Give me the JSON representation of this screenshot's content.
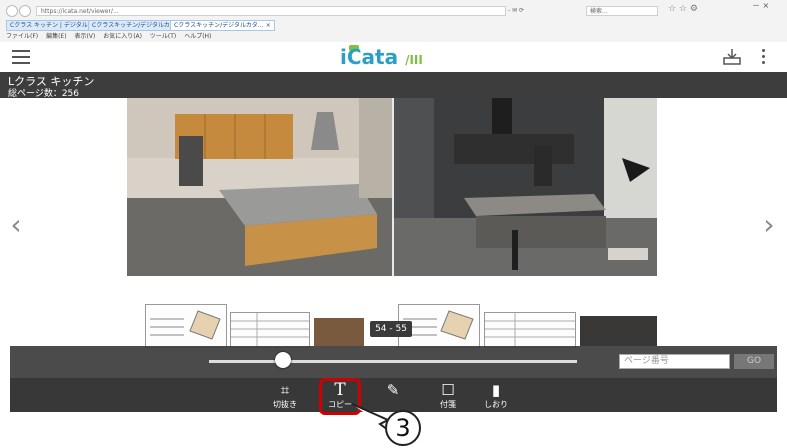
{
  "browser": {
    "url": "https://icata.net/viewer/...",
    "address_right": "- ✉ ⟳",
    "search_placeholder": "検索...",
    "tabs": [
      "Cクラス キッチン | デジタルカタ…",
      "Cクラスキッチン/デジタルカタ… ×",
      "Cクラスキッチン/デジタルカタ… ×"
    ],
    "menu": [
      "ファイル(F)",
      "編集(E)",
      "表示(V)",
      "お気に入り(A)",
      "ツール(T)",
      "ヘルプ(H)"
    ]
  },
  "app": {
    "logo": "iCata",
    "logo_suffix": "/III"
  },
  "catalog": {
    "title": "Lクラス キッチン",
    "total_pages": "総ページ数：256"
  },
  "viewer": {
    "prev_arrow": "‹",
    "next_arrow": "›",
    "page_indicator": "54 - 55",
    "slider_fraction": 0.2
  },
  "page_jump": {
    "placeholder": "ページ番号",
    "go_label": "GO"
  },
  "toolbar": {
    "items": [
      {
        "icon": "crop-icon",
        "glyph": "⌗",
        "label": "切抜き"
      },
      {
        "icon": "text-copy-icon",
        "glyph": "T",
        "label": "コピー"
      },
      {
        "icon": "pen-icon",
        "glyph": "✎",
        "label": "ペン"
      },
      {
        "icon": "sticky-note-icon",
        "glyph": "☐",
        "label": "付箋"
      },
      {
        "icon": "bookmark-icon",
        "glyph": "▮",
        "label": "しおり"
      }
    ]
  },
  "annotation": {
    "step_number": "3",
    "highlight_color": "#d10000"
  },
  "colors": {
    "logo_blue": "#2aa0c7",
    "logo_green": "#7cc242",
    "header_dark": "#3d3d3d"
  }
}
